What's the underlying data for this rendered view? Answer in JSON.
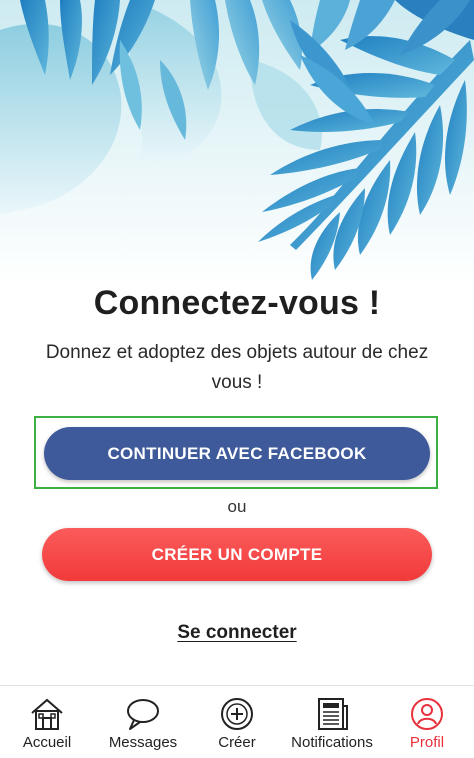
{
  "screen": {
    "title": "Connectez-vous !",
    "subtitle": "Donnez et adoptez des objets autour de chez vous !"
  },
  "buttons": {
    "facebook_label": "CONTINUER AVEC FACEBOOK",
    "or_label": "ou",
    "create_account_label": "CRÉER UN COMPTE",
    "login_label": "Se connecter"
  },
  "tabbar": {
    "items": [
      {
        "label": "Accueil",
        "icon": "house-icon",
        "active": false
      },
      {
        "label": "Messages",
        "icon": "speech-bubble-icon",
        "active": false
      },
      {
        "label": "Créer",
        "icon": "plus-circle-icon",
        "active": false
      },
      {
        "label": "Notifications",
        "icon": "newspaper-icon",
        "active": false
      },
      {
        "label": "Profil",
        "icon": "user-circle-icon",
        "active": true
      }
    ]
  },
  "colors": {
    "facebook": "#3f5a9a",
    "create": "#f23a3a",
    "active_tab": "#e8313c",
    "leaf_light": "#8fcfde",
    "leaf_dark": "#2f86bf",
    "highlight": "#3cb043"
  }
}
